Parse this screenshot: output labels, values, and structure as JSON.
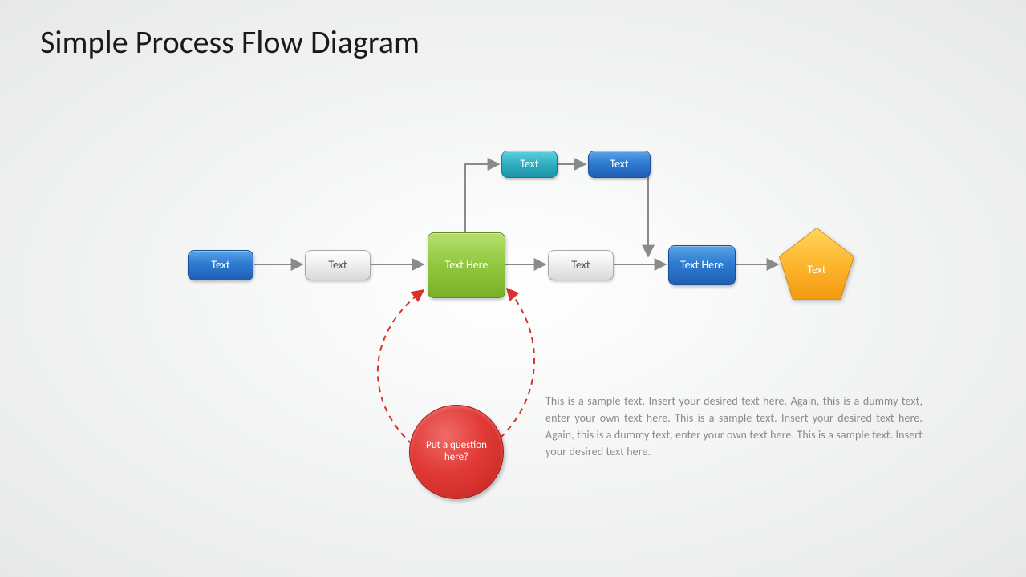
{
  "title": "Simple Process Flow Diagram",
  "nodes": {
    "n1": "Text",
    "n2": "Text",
    "n3": "Text Here",
    "n4": "Text",
    "n5": "Text Here",
    "n6": "Text",
    "t1": "Text",
    "t2": "Text",
    "q": "Put a question here?"
  },
  "body_text": "This is a sample text. Insert your desired text here. Again, this is a dummy text, enter your own text here. This is a sample text. Insert your desired text here. Again, this is a dummy text, enter your own text here. This is a sample text. Insert your desired text here.",
  "colors": {
    "arrow": "#8a8a8a",
    "dashed": "#d7322b"
  }
}
